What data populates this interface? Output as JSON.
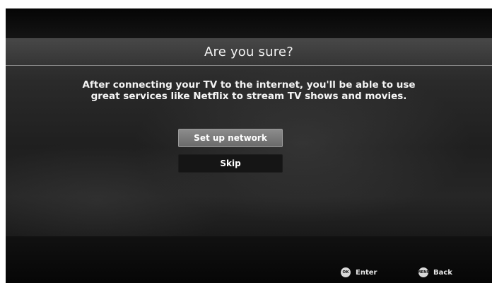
{
  "dialog": {
    "title": "Are you sure?",
    "message_line1": "After connecting your TV to the internet, you'll be able to use",
    "message_line2": "great services like Netflix to stream TV shows and movies."
  },
  "buttons": {
    "setup_label": "Set up network",
    "skip_label": "Skip"
  },
  "footer": {
    "enter_icon": "OK",
    "enter_label": "Enter",
    "back_icon": "MENU",
    "back_label": "Back"
  },
  "colors": {
    "panel": "#2a2a2a",
    "selected_button": "#7a7a7a",
    "unselected_button": "#151515",
    "text": "#f4f4f4"
  }
}
